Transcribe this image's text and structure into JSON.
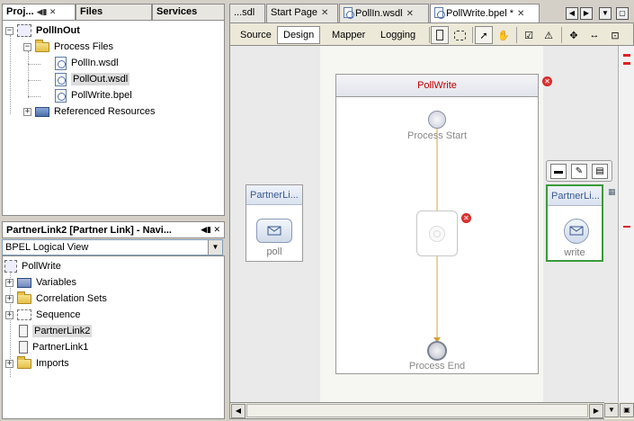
{
  "left": {
    "tabs": [
      {
        "label": "Proj...",
        "pin": "◀▮ ✕"
      },
      {
        "label": "Files",
        "pin": ""
      },
      {
        "label": "Services",
        "pin": ""
      }
    ],
    "project_tree": {
      "root": "PollInOut",
      "process_files": "Process Files",
      "files": [
        "PollIn.wsdl",
        "PollOut.wsdl",
        "PollWrite.bpel"
      ],
      "referenced": "Referenced Resources"
    },
    "navigator": {
      "title": "PartnerLink2 [Partner Link] - Navi...",
      "controls": "◀▮ ✕",
      "view_select": "BPEL Logical View",
      "root": "PollWrite",
      "items": [
        "Variables",
        "Correlation Sets",
        "Sequence",
        "PartnerLink2",
        "PartnerLink1",
        "Imports"
      ]
    }
  },
  "editor": {
    "tabs": [
      {
        "label": "...sdl",
        "close": ""
      },
      {
        "label": "Start Page",
        "close": "✕"
      },
      {
        "label": "PollIn.wsdl",
        "close": "✕"
      },
      {
        "label": "PollWrite.bpel *",
        "close": "✕"
      }
    ],
    "nav_buttons": [
      "◀",
      "▶",
      "▼",
      "▢"
    ],
    "views": [
      "Source",
      "Design",
      "Mapper",
      "Logging"
    ],
    "active_view": "Design"
  },
  "diagram": {
    "process_name": "PollWrite",
    "start_label": "Process Start",
    "end_label": "Process End",
    "left_partner": {
      "title": "PartnerLi...",
      "label": "poll"
    },
    "right_partner": {
      "title": "PartnerLi...",
      "label": "write"
    },
    "flow_color": "#d4a040",
    "error_color": "#d02020",
    "selection_color": "#3a9a3a"
  }
}
